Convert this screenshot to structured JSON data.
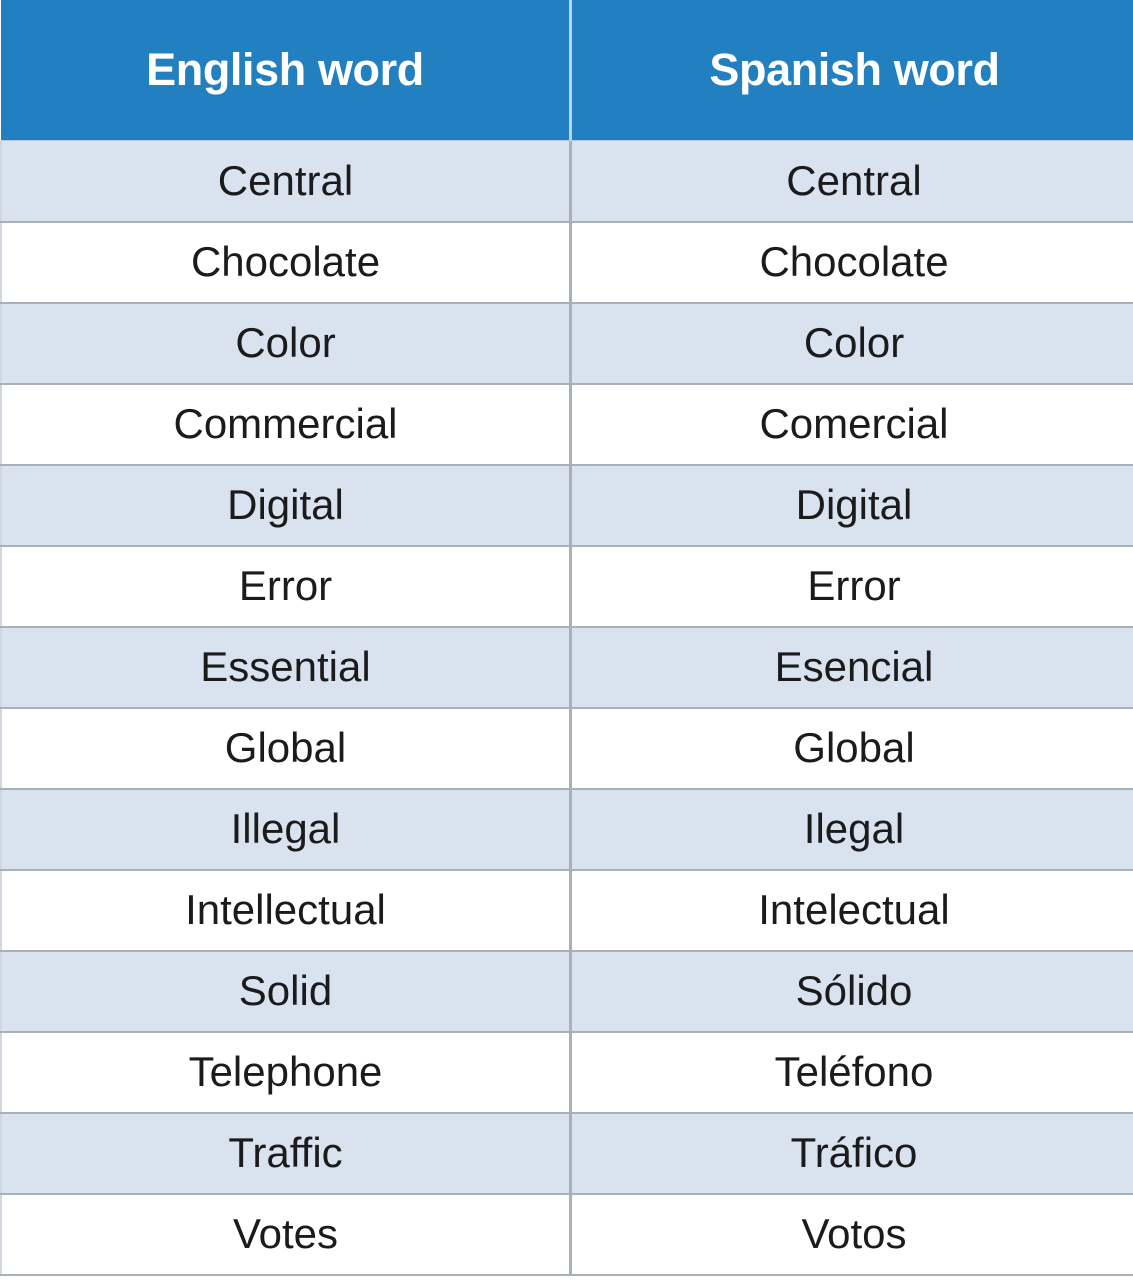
{
  "table": {
    "columns": [
      {
        "key": "english",
        "label": "English word"
      },
      {
        "key": "spanish",
        "label": "Spanish word"
      }
    ],
    "header_background": "#2380c0",
    "header_text_color": "#ffffff",
    "shaded_row_background": "#d9e3ef",
    "plain_row_background": "#ffffff",
    "grid_line_color": "#a9b0b7",
    "body_text_color": "#1b1b1b",
    "row_count": 14,
    "rows": [
      {
        "english": "Central",
        "spanish": "Central"
      },
      {
        "english": "Chocolate",
        "spanish": "Chocolate"
      },
      {
        "english": "Color",
        "spanish": "Color"
      },
      {
        "english": "Commercial",
        "spanish": "Comercial"
      },
      {
        "english": "Digital",
        "spanish": "Digital"
      },
      {
        "english": "Error",
        "spanish": "Error"
      },
      {
        "english": "Essential",
        "spanish": "Esencial"
      },
      {
        "english": "Global",
        "spanish": "Global"
      },
      {
        "english": "Illegal",
        "spanish": "Ilegal"
      },
      {
        "english": "Intellectual",
        "spanish": "Intelectual"
      },
      {
        "english": "Solid",
        "spanish": "Sólido"
      },
      {
        "english": "Telephone",
        "spanish": "Teléfono"
      },
      {
        "english": "Traffic",
        "spanish": "Tráfico"
      },
      {
        "english": "Votes",
        "spanish": "Votos"
      }
    ]
  }
}
